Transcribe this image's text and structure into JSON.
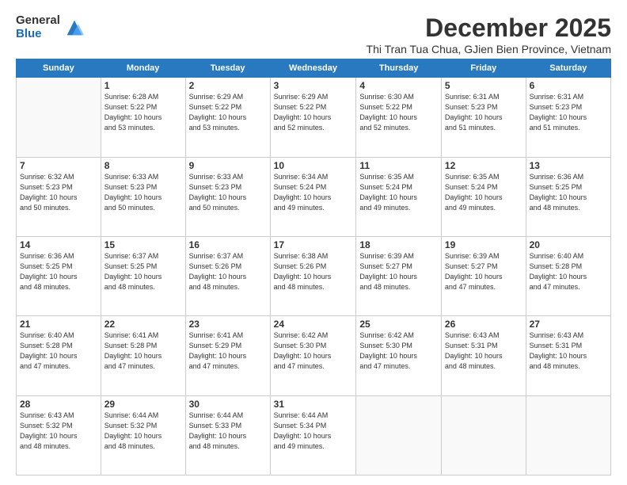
{
  "logo": {
    "general": "General",
    "blue": "Blue"
  },
  "header": {
    "month": "December 2025",
    "location": "Thi Tran Tua Chua, GJien Bien Province, Vietnam"
  },
  "days_of_week": [
    "Sunday",
    "Monday",
    "Tuesday",
    "Wednesday",
    "Thursday",
    "Friday",
    "Saturday"
  ],
  "weeks": [
    [
      {
        "day": "",
        "sunrise": "",
        "sunset": "",
        "daylight": ""
      },
      {
        "day": "1",
        "sunrise": "Sunrise: 6:28 AM",
        "sunset": "Sunset: 5:22 PM",
        "daylight": "Daylight: 10 hours and 53 minutes."
      },
      {
        "day": "2",
        "sunrise": "Sunrise: 6:29 AM",
        "sunset": "Sunset: 5:22 PM",
        "daylight": "Daylight: 10 hours and 53 minutes."
      },
      {
        "day": "3",
        "sunrise": "Sunrise: 6:29 AM",
        "sunset": "Sunset: 5:22 PM",
        "daylight": "Daylight: 10 hours and 52 minutes."
      },
      {
        "day": "4",
        "sunrise": "Sunrise: 6:30 AM",
        "sunset": "Sunset: 5:22 PM",
        "daylight": "Daylight: 10 hours and 52 minutes."
      },
      {
        "day": "5",
        "sunrise": "Sunrise: 6:31 AM",
        "sunset": "Sunset: 5:23 PM",
        "daylight": "Daylight: 10 hours and 51 minutes."
      },
      {
        "day": "6",
        "sunrise": "Sunrise: 6:31 AM",
        "sunset": "Sunset: 5:23 PM",
        "daylight": "Daylight: 10 hours and 51 minutes."
      }
    ],
    [
      {
        "day": "7",
        "sunrise": "Sunrise: 6:32 AM",
        "sunset": "Sunset: 5:23 PM",
        "daylight": "Daylight: 10 hours and 50 minutes."
      },
      {
        "day": "8",
        "sunrise": "Sunrise: 6:33 AM",
        "sunset": "Sunset: 5:23 PM",
        "daylight": "Daylight: 10 hours and 50 minutes."
      },
      {
        "day": "9",
        "sunrise": "Sunrise: 6:33 AM",
        "sunset": "Sunset: 5:23 PM",
        "daylight": "Daylight: 10 hours and 50 minutes."
      },
      {
        "day": "10",
        "sunrise": "Sunrise: 6:34 AM",
        "sunset": "Sunset: 5:24 PM",
        "daylight": "Daylight: 10 hours and 49 minutes."
      },
      {
        "day": "11",
        "sunrise": "Sunrise: 6:35 AM",
        "sunset": "Sunset: 5:24 PM",
        "daylight": "Daylight: 10 hours and 49 minutes."
      },
      {
        "day": "12",
        "sunrise": "Sunrise: 6:35 AM",
        "sunset": "Sunset: 5:24 PM",
        "daylight": "Daylight: 10 hours and 49 minutes."
      },
      {
        "day": "13",
        "sunrise": "Sunrise: 6:36 AM",
        "sunset": "Sunset: 5:25 PM",
        "daylight": "Daylight: 10 hours and 48 minutes."
      }
    ],
    [
      {
        "day": "14",
        "sunrise": "Sunrise: 6:36 AM",
        "sunset": "Sunset: 5:25 PM",
        "daylight": "Daylight: 10 hours and 48 minutes."
      },
      {
        "day": "15",
        "sunrise": "Sunrise: 6:37 AM",
        "sunset": "Sunset: 5:25 PM",
        "daylight": "Daylight: 10 hours and 48 minutes."
      },
      {
        "day": "16",
        "sunrise": "Sunrise: 6:37 AM",
        "sunset": "Sunset: 5:26 PM",
        "daylight": "Daylight: 10 hours and 48 minutes."
      },
      {
        "day": "17",
        "sunrise": "Sunrise: 6:38 AM",
        "sunset": "Sunset: 5:26 PM",
        "daylight": "Daylight: 10 hours and 48 minutes."
      },
      {
        "day": "18",
        "sunrise": "Sunrise: 6:39 AM",
        "sunset": "Sunset: 5:27 PM",
        "daylight": "Daylight: 10 hours and 48 minutes."
      },
      {
        "day": "19",
        "sunrise": "Sunrise: 6:39 AM",
        "sunset": "Sunset: 5:27 PM",
        "daylight": "Daylight: 10 hours and 47 minutes."
      },
      {
        "day": "20",
        "sunrise": "Sunrise: 6:40 AM",
        "sunset": "Sunset: 5:28 PM",
        "daylight": "Daylight: 10 hours and 47 minutes."
      }
    ],
    [
      {
        "day": "21",
        "sunrise": "Sunrise: 6:40 AM",
        "sunset": "Sunset: 5:28 PM",
        "daylight": "Daylight: 10 hours and 47 minutes."
      },
      {
        "day": "22",
        "sunrise": "Sunrise: 6:41 AM",
        "sunset": "Sunset: 5:28 PM",
        "daylight": "Daylight: 10 hours and 47 minutes."
      },
      {
        "day": "23",
        "sunrise": "Sunrise: 6:41 AM",
        "sunset": "Sunset: 5:29 PM",
        "daylight": "Daylight: 10 hours and 47 minutes."
      },
      {
        "day": "24",
        "sunrise": "Sunrise: 6:42 AM",
        "sunset": "Sunset: 5:30 PM",
        "daylight": "Daylight: 10 hours and 47 minutes."
      },
      {
        "day": "25",
        "sunrise": "Sunrise: 6:42 AM",
        "sunset": "Sunset: 5:30 PM",
        "daylight": "Daylight: 10 hours and 47 minutes."
      },
      {
        "day": "26",
        "sunrise": "Sunrise: 6:43 AM",
        "sunset": "Sunset: 5:31 PM",
        "daylight": "Daylight: 10 hours and 48 minutes."
      },
      {
        "day": "27",
        "sunrise": "Sunrise: 6:43 AM",
        "sunset": "Sunset: 5:31 PM",
        "daylight": "Daylight: 10 hours and 48 minutes."
      }
    ],
    [
      {
        "day": "28",
        "sunrise": "Sunrise: 6:43 AM",
        "sunset": "Sunset: 5:32 PM",
        "daylight": "Daylight: 10 hours and 48 minutes."
      },
      {
        "day": "29",
        "sunrise": "Sunrise: 6:44 AM",
        "sunset": "Sunset: 5:32 PM",
        "daylight": "Daylight: 10 hours and 48 minutes."
      },
      {
        "day": "30",
        "sunrise": "Sunrise: 6:44 AM",
        "sunset": "Sunset: 5:33 PM",
        "daylight": "Daylight: 10 hours and 48 minutes."
      },
      {
        "day": "31",
        "sunrise": "Sunrise: 6:44 AM",
        "sunset": "Sunset: 5:34 PM",
        "daylight": "Daylight: 10 hours and 49 minutes."
      },
      {
        "day": "",
        "sunrise": "",
        "sunset": "",
        "daylight": ""
      },
      {
        "day": "",
        "sunrise": "",
        "sunset": "",
        "daylight": ""
      },
      {
        "day": "",
        "sunrise": "",
        "sunset": "",
        "daylight": ""
      }
    ]
  ]
}
